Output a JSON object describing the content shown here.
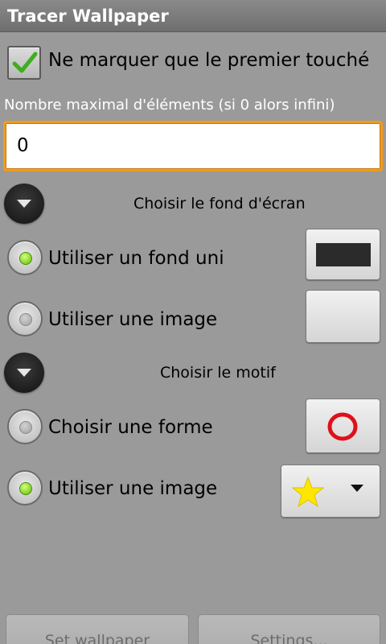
{
  "app": {
    "title": "Tracer Wallpaper"
  },
  "first_touch": {
    "label": "Ne marquer que le premier touché",
    "checked": true
  },
  "max_elements": {
    "label": "Nombre maximal d'éléments (si 0 alors infini)",
    "value": "0"
  },
  "background_group": {
    "title": "Choisir le fond d'écran",
    "options": [
      {
        "label": "Utiliser un fond uni",
        "selected": true,
        "swatch_color": "#2b2b2b"
      },
      {
        "label": "Utiliser une image",
        "selected": false
      }
    ]
  },
  "pattern_group": {
    "title": "Choisir le motif",
    "options": [
      {
        "label": "Choisir une forme",
        "selected": false,
        "shape": "red-ring-icon",
        "shape_color": "#e0101a"
      },
      {
        "label": "Utiliser une image",
        "selected": true,
        "image": "yellow-star-icon",
        "image_color": "#ffe600"
      }
    ]
  },
  "footer": {
    "set_wallpaper": "Set wallpaper",
    "settings": "Settings..."
  },
  "colors": {
    "accent_orange": "#f29b1c",
    "radio_green": "#5bbd08"
  }
}
